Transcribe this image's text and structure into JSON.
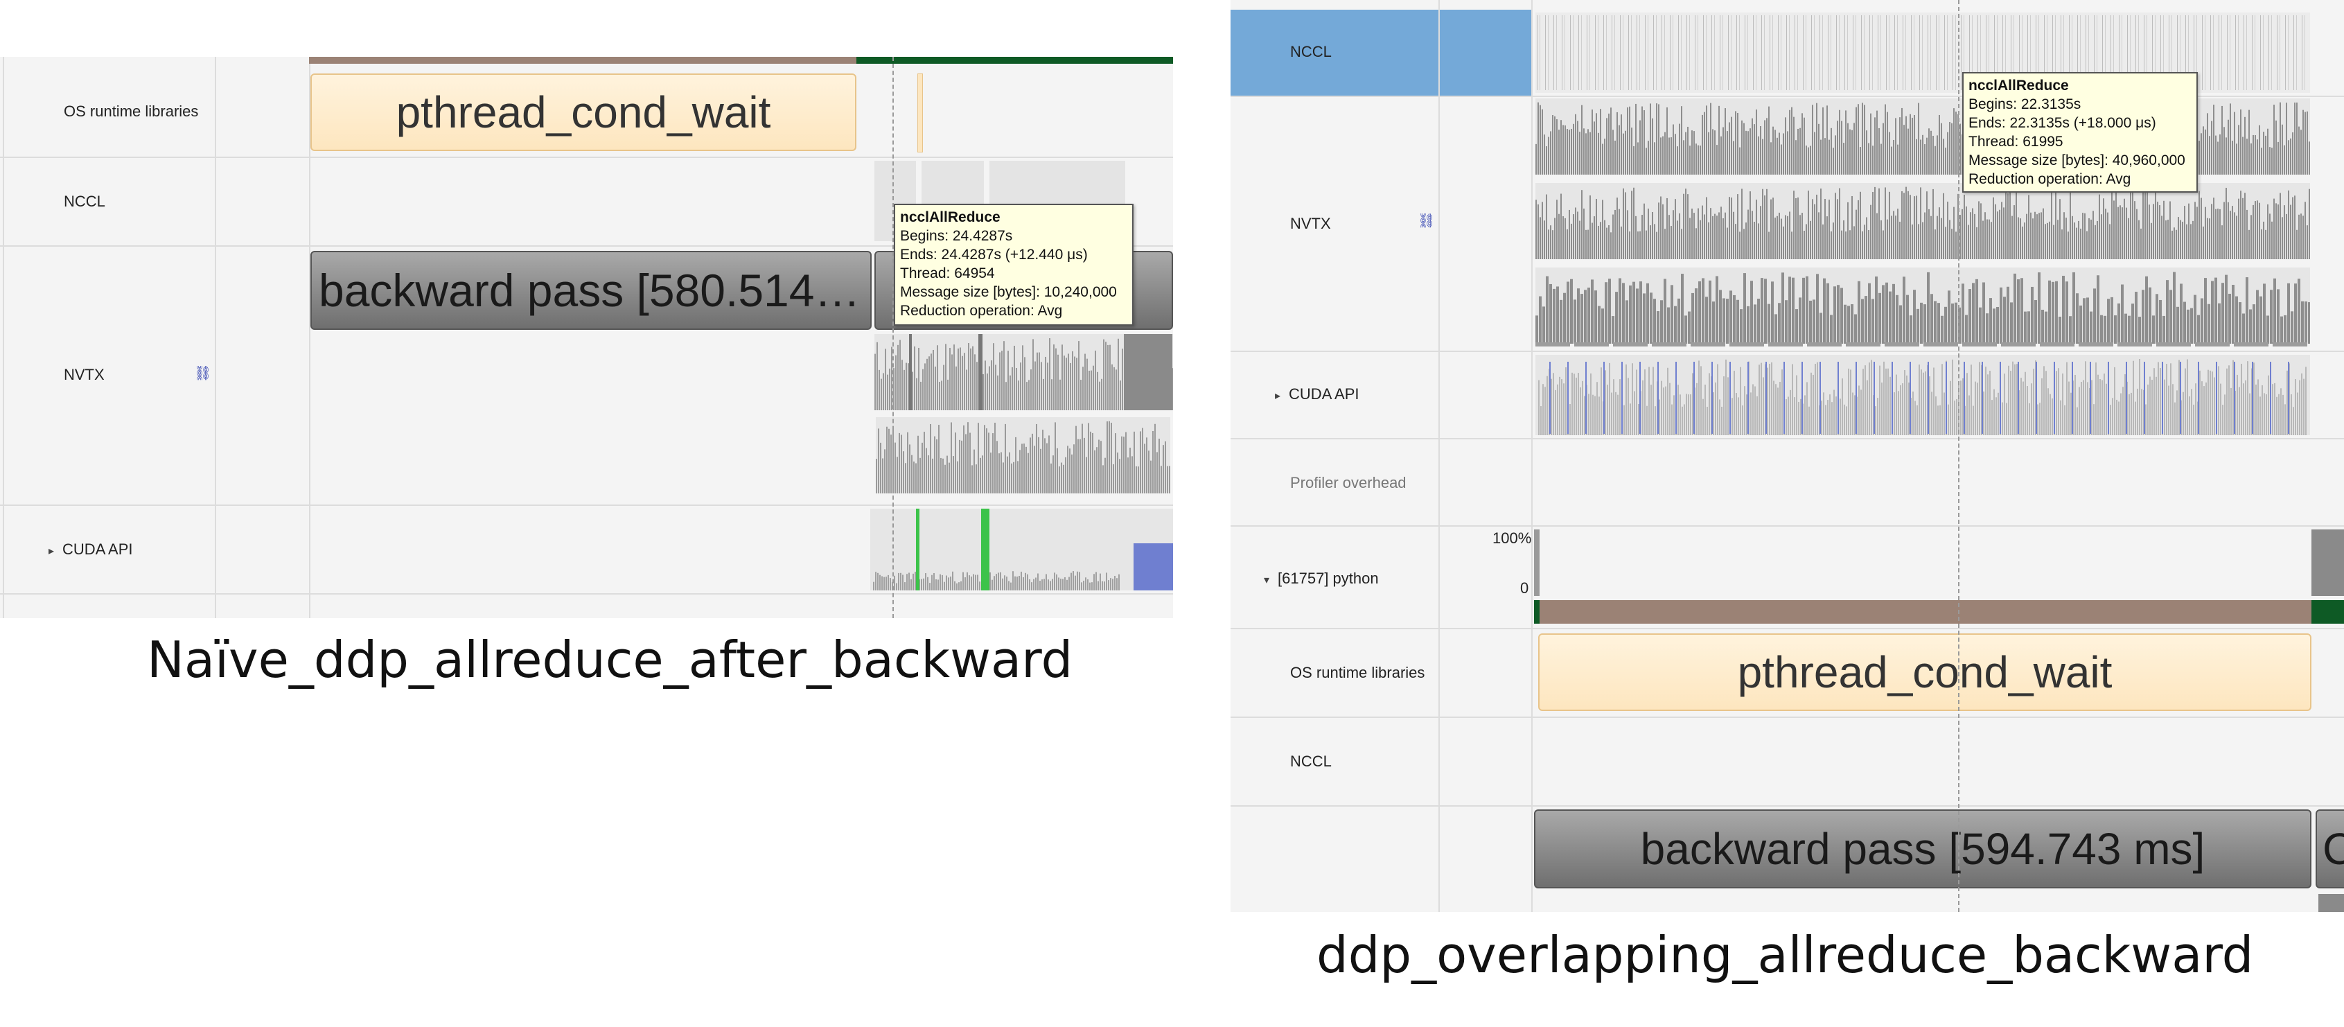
{
  "left": {
    "rows": {
      "os_runtime": "OS runtime libraries",
      "nccl": "NCCL",
      "nvtx": "NVTX",
      "cuda_api": "CUDA API"
    },
    "pthread_label": "pthread_cond_wait",
    "backward_label": "backward pass [580.514…",
    "tooltip": {
      "title": "ncclAllReduce",
      "begins": "Begins: 24.4287s",
      "ends": "Ends: 24.4287s (+12.440 μs)",
      "thread": "Thread: 64954",
      "msg_size": "Message size [bytes]: 10,240,000",
      "reduction": "Reduction operation: Avg"
    },
    "caption": "Naïve_ddp_allreduce_after_backward"
  },
  "right": {
    "rows": {
      "nccl_top": "NCCL",
      "nvtx": "NVTX",
      "cuda_api": "CUDA API",
      "profiler_overhead": "Profiler overhead",
      "python": "[61757] python",
      "os_runtime": "OS runtime libraries",
      "nccl_bottom": "NCCL"
    },
    "axis_max": "100%",
    "axis_min": "0",
    "pthread_label": "pthread_cond_wait",
    "backward_label": "backward pass [594.743 ms]",
    "next_label": "C",
    "tooltip": {
      "title": "ncclAllReduce",
      "begins": "Begins: 22.3135s",
      "ends": "Ends: 22.3135s (+18.000 μs)",
      "thread": "Thread: 61995",
      "msg_size": "Message size [bytes]: 40,960,000",
      "reduction": "Reduction operation: Avg"
    },
    "caption": "ddp_overlapping_allreduce_backward"
  },
  "colors": {
    "brown_bar": "#9b8275",
    "green_bar": "#0e5a25",
    "selected_row": "#74a9d8",
    "tooltip_bg": "#ffffe1",
    "cuda_green": "#3cc34a",
    "cuda_blue": "#6f7fd0"
  },
  "icons": {
    "nvtx_link": "link-icon",
    "expand": "caret-right-icon",
    "collapse": "caret-down-icon"
  }
}
